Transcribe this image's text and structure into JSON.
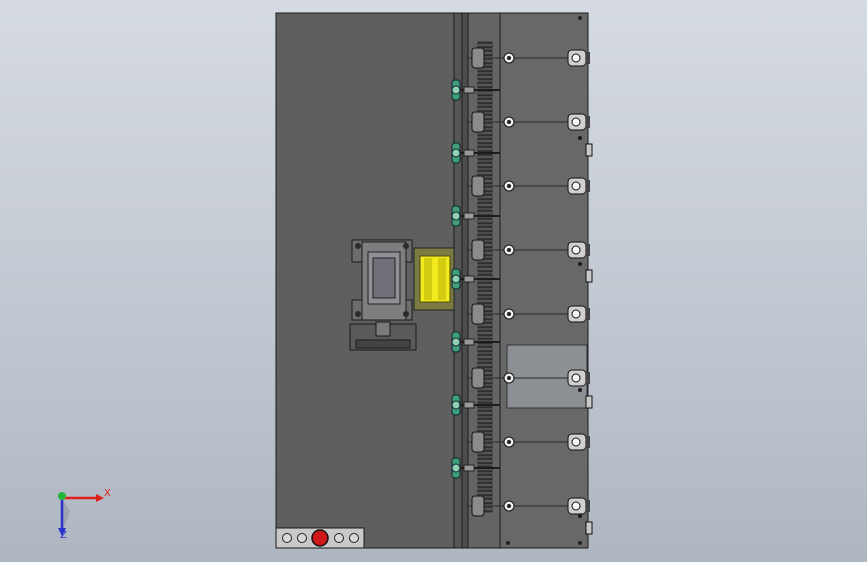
{
  "view": {
    "background_top": "#d6dbe2",
    "background_bottom": "#aeb6c1"
  },
  "model": {
    "frame_color": "#5f5f5f",
    "frame_edge": "#1c1c1c",
    "gear_color": "#3a3a3a",
    "highlight_color": "#f2ea1c",
    "knob_color": "#3f9f79",
    "control_button_color": "#d01818",
    "plate_color": "#8c8f94",
    "roller_count": 8,
    "nozzle_count": 7,
    "side_indicator_count": 4
  },
  "triad": {
    "x_label": "X",
    "z_label": "Z",
    "x_color": "#e0201b",
    "z_color": "#2a2fd0",
    "y_color": "#21b83a"
  }
}
